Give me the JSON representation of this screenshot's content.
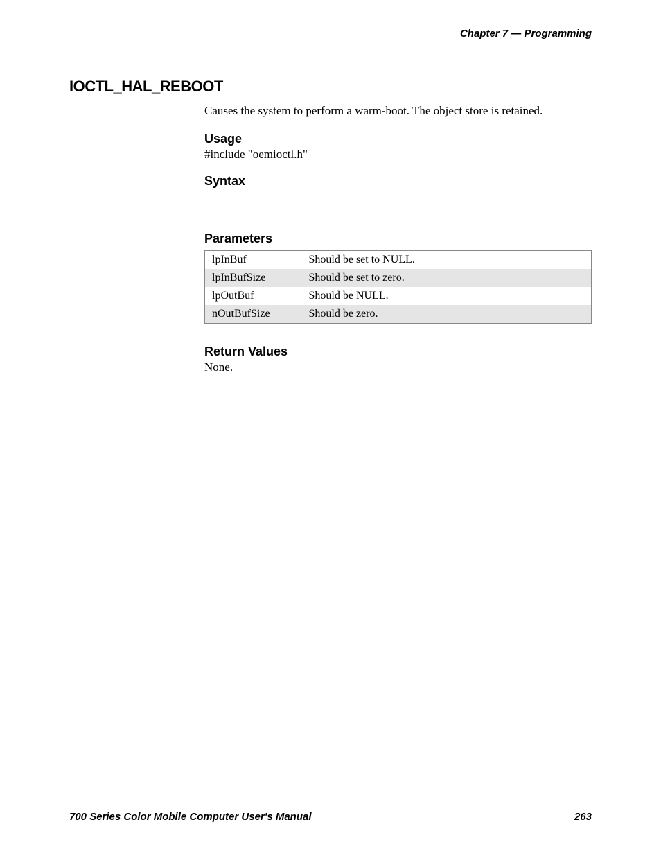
{
  "header": {
    "chapter": "Chapter 7 — Programming"
  },
  "section": {
    "title": "IOCTL_HAL_REBOOT",
    "description": "Causes the system to perform a warm-boot. The object store is retained."
  },
  "usage": {
    "heading": "Usage",
    "line": "#include \"oemioctl.h\""
  },
  "syntax": {
    "heading": "Syntax"
  },
  "parameters": {
    "heading": "Parameters",
    "rows": [
      {
        "name": "lpInBuf",
        "desc": "Should be set to NULL."
      },
      {
        "name": "lpInBufSize",
        "desc": "Should be set to zero."
      },
      {
        "name": "lpOutBuf",
        "desc": "Should be NULL."
      },
      {
        "name": "nOutBufSize",
        "desc": "Should be zero."
      }
    ]
  },
  "returnValues": {
    "heading": "Return Values",
    "text": "None."
  },
  "footer": {
    "manual": "700 Series Color Mobile Computer User's Manual",
    "page": "263"
  }
}
